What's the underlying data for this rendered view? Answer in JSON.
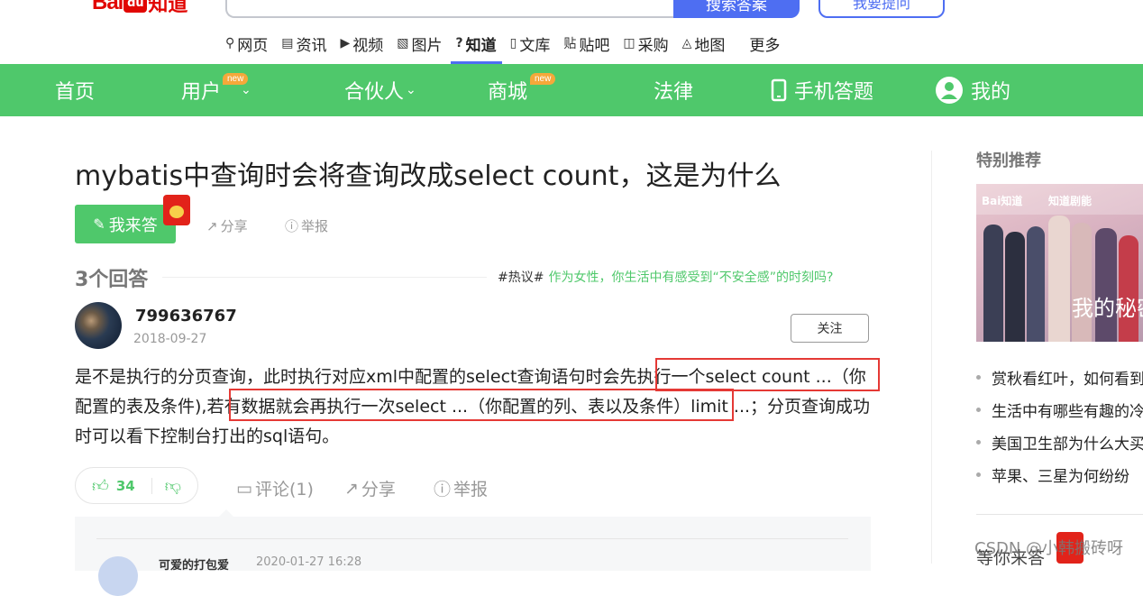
{
  "header": {
    "logo_bai": "Bai",
    "logo_du": "du",
    "logo_zhidao": "知道",
    "search_button": "搜索答案",
    "ask_button": "我要提问",
    "nav": [
      {
        "icon": "search-icon",
        "glyph": "⚲",
        "label": "网页"
      },
      {
        "icon": "news-icon",
        "glyph": "▤",
        "label": "资讯"
      },
      {
        "icon": "video-icon",
        "glyph": "▶",
        "label": "视频"
      },
      {
        "icon": "image-icon",
        "glyph": "▧",
        "label": "图片"
      },
      {
        "icon": "question-icon",
        "glyph": "?",
        "label": "知道"
      },
      {
        "icon": "doc-icon",
        "glyph": "▯",
        "label": "文库"
      },
      {
        "icon": "tieba-icon",
        "glyph": "贴",
        "label": "贴吧"
      },
      {
        "icon": "shop-icon",
        "glyph": "◫",
        "label": "采购"
      },
      {
        "icon": "map-icon",
        "glyph": "◬",
        "label": "地图"
      }
    ],
    "nav_more": "更多",
    "accent": "#4e6ef2"
  },
  "green_nav": {
    "color": "#4fc86b",
    "home": "首页",
    "user": "用户",
    "partner": "合伙人",
    "mall": "商城",
    "law": "法律",
    "mobile": "手机答题",
    "mine": "我的",
    "new_badge": "new"
  },
  "question": {
    "title": "mybatis中查询时会将查询改成select count，这是为什么",
    "answer_button": "我来答",
    "share": "分享",
    "report": "举报"
  },
  "answers": {
    "count_label": "3个回答",
    "hot_tag": "#热议#",
    "hot_text": "作为女性，你生活中有感受到“不安全感”的时刻吗?"
  },
  "answer": {
    "user": "799636767",
    "date": "2018-09-27",
    "follow": "关注",
    "text_part1": "是不是执行的分页查询，此时执行对应xml中配置的select查询语句时会先执行一个select count ...（你配置的表及条件),若有数据就会再执行一次select ...（你配置的列、表以及条件）limit ...；分页查询成功时可以看下控制台打出的sql语句。",
    "likes": "34",
    "comment": "评论(1)",
    "share": "分享",
    "report": "举报"
  },
  "comment": {
    "user": "可爱的打包爱",
    "date": "2020-01-27 16:28"
  },
  "sidebar": {
    "title": "特别推荐",
    "banner_brand": "Bai知道",
    "banner_show": "知道剧能",
    "banner_caption": "我的秘密",
    "items": [
      "赏秋看红叶，如何看到",
      "生活中有哪些有趣的冷",
      "美国卫生部为什么大买",
      "苹果、三星为何纷纷"
    ],
    "more": "等你来答"
  },
  "watermark": "CSDN @小韩搬砖呀",
  "highlight_color": "#e53935"
}
